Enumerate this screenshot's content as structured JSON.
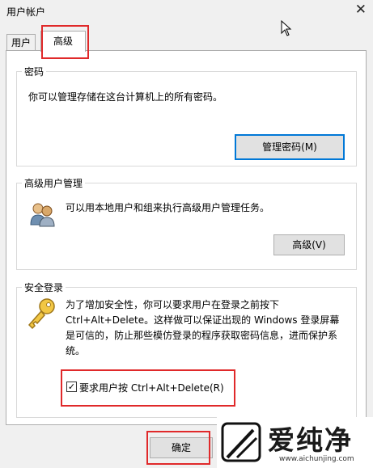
{
  "window": {
    "title": "用户帐户",
    "close_glyph": "✕"
  },
  "tabs": [
    {
      "label": "用户"
    },
    {
      "label": "高级"
    }
  ],
  "password_group": {
    "title": "密码",
    "description": "你可以管理存储在这台计算机上的所有密码。",
    "button": "管理密码(M)"
  },
  "user_mgmt_group": {
    "title": "高级用户管理",
    "description": "可以用本地用户和组来执行高级用户管理任务。",
    "button": "高级(V)"
  },
  "secure_logon_group": {
    "title": "安全登录",
    "description": "为了增加安全性，你可以要求用户在登录之前按下 Ctrl+Alt+Delete。这样做可以保证出现的 Windows 登录屏幕是可信的，防止那些模仿登录的程序获取密码信息，进而保护系统。",
    "checkbox_label": "要求用户按 Ctrl+Alt+Delete(R)",
    "checkbox_checked": true
  },
  "footer": {
    "ok_button": "确定"
  },
  "watermark": {
    "name": "爱纯净",
    "url": "www.aichunjing.com"
  },
  "colors": {
    "highlight": "#e0292a",
    "focus": "#0078d7",
    "panel": "#ffffff",
    "window": "#f0f0f0"
  }
}
